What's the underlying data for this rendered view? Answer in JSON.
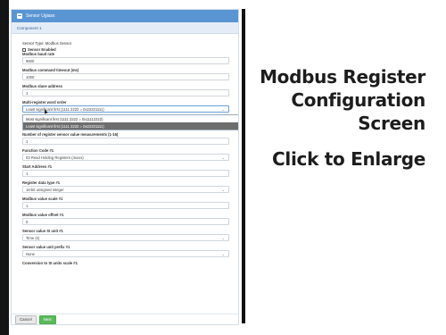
{
  "window": {
    "title": "Sensor Ugiass"
  },
  "section": {
    "header": "Component 1"
  },
  "form": {
    "sensor_type": "Sensor Type: Modbus Sensor",
    "sensor_enabled_label": "Sensor Enabled",
    "baud_label": "Modbus baud rate",
    "baud_value": "9600",
    "timeout_label": "Modbus command timeout (ms)",
    "timeout_value": "1000",
    "address_label": "Modbus slave address",
    "address_value": "1",
    "word_order_label": "Multi-register word order",
    "word_order_value": "Least significant first (1111 2222 = 0x22221111)",
    "word_order_options": [
      "Most significant first (1111 2222 = 0x11112222)",
      "Least significant first (1111 2222 = 0x22221111)"
    ],
    "count_label": "Number of register sensor value measurements (1-16)",
    "count_value": "1",
    "function_label": "Function Code #1",
    "function_value": "03 Read Holding Registers (4xxxx)",
    "start_label": "Start Address #1",
    "start_value": "1",
    "datatype_label": "Register data type #1",
    "datatype_value": "16-bit unsigned integer",
    "scale_label": "Modbus value scale #1",
    "scale_value": "1",
    "offset_label": "Modbus value offset #1",
    "offset_value": "0",
    "si_unit_label": "Sensor value SI unit #1",
    "si_unit_value": "Time (s)",
    "prefix_label": "Sensor value unit prefix #1",
    "prefix_value": "None",
    "conversion_label": "Conversion to SI units scale #1"
  },
  "footer": {
    "cancel_label": "Cancel",
    "next_label": "Next"
  },
  "caption": {
    "title_line1": "Modbus Register",
    "title_line2": "Configuration",
    "title_line3": "Screen",
    "subtitle": "Click to Enlarge"
  }
}
